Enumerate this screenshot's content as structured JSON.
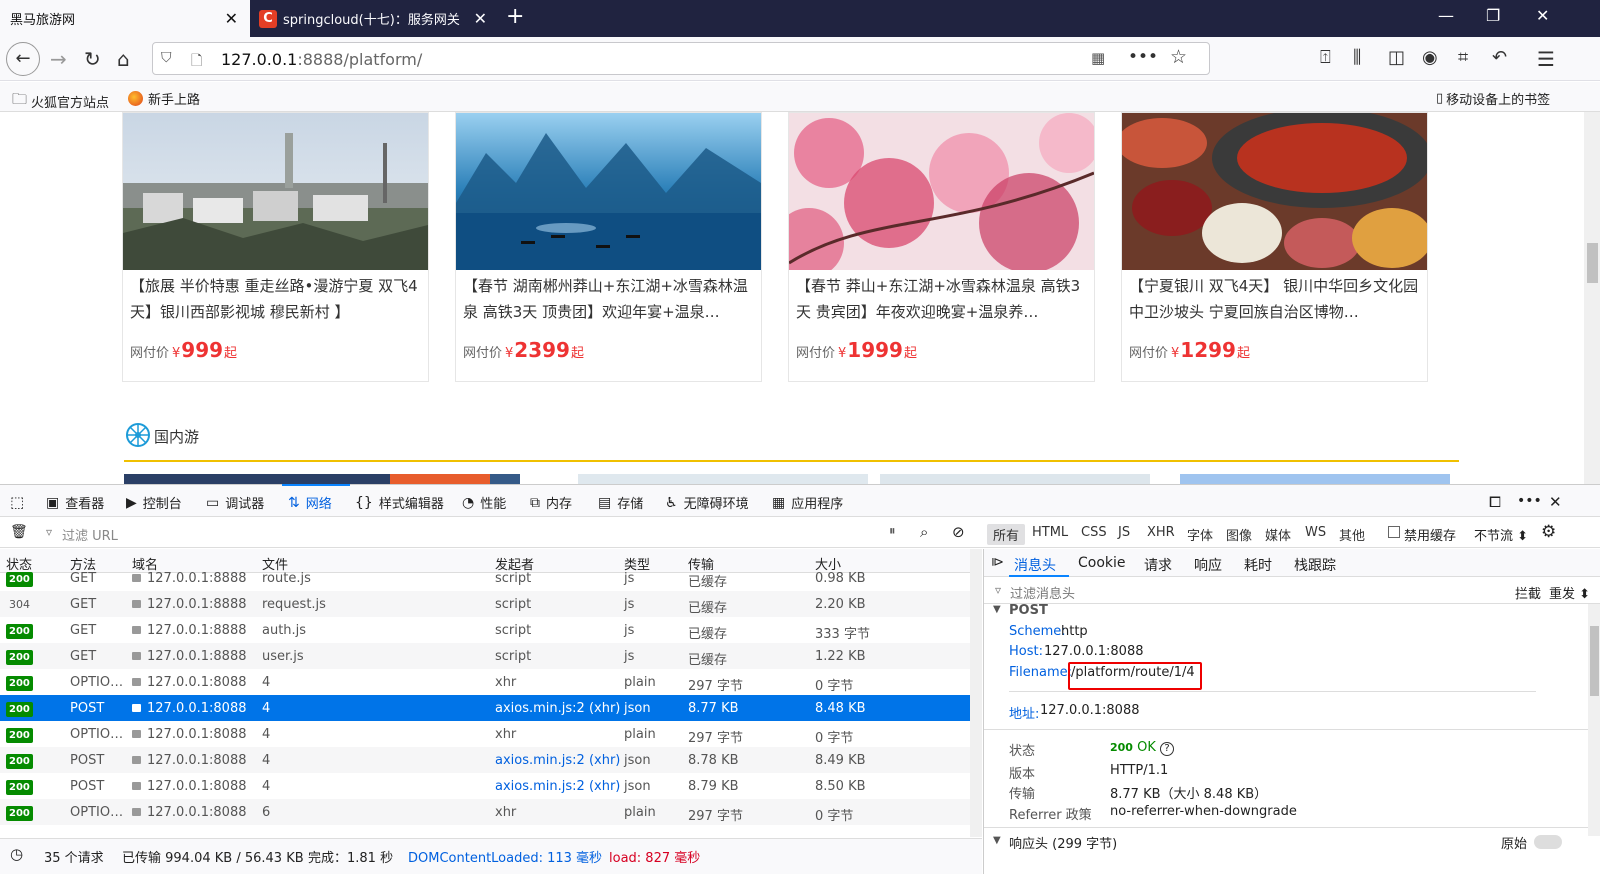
{
  "browser": {
    "tabs": [
      {
        "title": "黑马旅游网"
      },
      {
        "title": "springcloud(十七)：服务网关",
        "favicon": "C"
      }
    ],
    "url_host": "127.0.0.1",
    "url_rest": ":8888/platform/",
    "bookmarks": [
      "火狐官方站点",
      "新手上路"
    ],
    "mobile_bookmarks": "移动设备上的书签"
  },
  "page": {
    "cards": [
      {
        "title": "【旅展 半价特惠 重走丝路•漫游宁夏 双飞4天】银川西部影视城 穆民新村 】",
        "price_label": "网付价",
        "currency": "¥",
        "price": "999",
        "suffix": "起"
      },
      {
        "title": "【春节 湖南郴州莽山+东江湖+冰雪森林温泉 高铁3天 顶贵团】欢迎年宴+温泉…",
        "price_label": "网付价",
        "currency": "¥",
        "price": "2399",
        "suffix": "起"
      },
      {
        "title": "【春节 莽山+东江湖+冰雪森林温泉 高铁3天 贵宾团】年夜欢迎晚宴+温泉养…",
        "price_label": "网付价",
        "currency": "¥",
        "price": "1999",
        "suffix": "起"
      },
      {
        "title": "【宁夏银川 双飞4天】 银川中华回乡文化园 中卫沙坡头 宁夏回族自治区博物…",
        "price_label": "网付价",
        "currency": "¥",
        "price": "1299",
        "suffix": "起"
      }
    ],
    "section_title": "国内游"
  },
  "devtools": {
    "tabs": [
      "查看器",
      "控制台",
      "调试器",
      "网络",
      "样式编辑器",
      "性能",
      "内存",
      "存储",
      "无障碍环境",
      "应用程序"
    ],
    "filter_placeholder": "过滤 URL",
    "type_filters": [
      "所有",
      "HTML",
      "CSS",
      "JS",
      "XHR",
      "字体",
      "图像",
      "媒体",
      "WS",
      "其他"
    ],
    "disable_cache": "禁用缓存",
    "throttle": "不节流 ⬍",
    "columns": [
      "状态",
      "方法",
      "域名",
      "文件",
      "发起者",
      "类型",
      "传输",
      "大小"
    ],
    "rows": [
      {
        "status": "200",
        "method": "GET",
        "domain": "127.0.0.1:8888",
        "file": "route.js",
        "initiator": "script",
        "type": "js",
        "transfer": "已缓存",
        "size": "0.98 KB"
      },
      {
        "status": "304",
        "method": "GET",
        "domain": "127.0.0.1:8888",
        "file": "request.js",
        "initiator": "script",
        "type": "js",
        "transfer": "已缓存",
        "size": "2.20 KB"
      },
      {
        "status": "200",
        "method": "GET",
        "domain": "127.0.0.1:8888",
        "file": "auth.js",
        "initiator": "script",
        "type": "js",
        "transfer": "已缓存",
        "size": "333 字节"
      },
      {
        "status": "200",
        "method": "GET",
        "domain": "127.0.0.1:8888",
        "file": "user.js",
        "initiator": "script",
        "type": "js",
        "transfer": "已缓存",
        "size": "1.22 KB"
      },
      {
        "status": "200",
        "method": "OPTIO…",
        "domain": "127.0.0.1:8088",
        "file": "4",
        "initiator": "xhr",
        "type": "plain",
        "transfer": "297 字节",
        "size": "0 字节"
      },
      {
        "status": "200",
        "method": "POST",
        "domain": "127.0.0.1:8088",
        "file": "4",
        "initiator": "axios.min.js:2 (xhr)",
        "type": "json",
        "transfer": "8.77 KB",
        "size": "8.48 KB"
      },
      {
        "status": "200",
        "method": "OPTIO…",
        "domain": "127.0.0.1:8088",
        "file": "4",
        "initiator": "xhr",
        "type": "plain",
        "transfer": "297 字节",
        "size": "0 字节"
      },
      {
        "status": "200",
        "method": "POST",
        "domain": "127.0.0.1:8088",
        "file": "4",
        "initiator": "axios.min.js:2 (xhr)",
        "type": "json",
        "transfer": "8.78 KB",
        "size": "8.49 KB"
      },
      {
        "status": "200",
        "method": "POST",
        "domain": "127.0.0.1:8088",
        "file": "4",
        "initiator": "axios.min.js:2 (xhr)",
        "type": "json",
        "transfer": "8.79 KB",
        "size": "8.50 KB"
      },
      {
        "status": "200",
        "method": "OPTIO…",
        "domain": "127.0.0.1:8088",
        "file": "6",
        "initiator": "xhr",
        "type": "plain",
        "transfer": "297 字节",
        "size": "0 字节"
      }
    ],
    "status": {
      "requests": "35 个请求",
      "transferred": "已传输 994.04 KB / 56.43 KB",
      "finish": "完成：1.81 秒",
      "dcl": "DOMContentLoaded: 113 毫秒",
      "load": "load: 827 毫秒"
    },
    "detail": {
      "tabs": [
        "消息头",
        "Cookie",
        "请求",
        "响应",
        "耗时",
        "栈跟踪"
      ],
      "filter_placeholder": "过滤消息头",
      "block": "拦截",
      "resend": "重发 ⬍",
      "method": "POST",
      "scheme_label": "Scheme:",
      "scheme": "http",
      "host_label": "Host:",
      "host": "127.0.0.1:8088",
      "filename_label": "Filename:",
      "filename": "/platform/route/1/4",
      "address_label": "地址:",
      "address": "127.0.0.1:8088",
      "status_label": "状态",
      "status_code": "200",
      "status_text": "OK",
      "version_label": "版本",
      "version": "HTTP/1.1",
      "transfer_label": "传输",
      "transfer": "8.77 KB（大小 8.48 KB）",
      "referrer_label": "Referrer 政策",
      "referrer": "no-referrer-when-downgrade",
      "response_headers": "响应头 (299 字节)",
      "raw": "原始"
    }
  }
}
